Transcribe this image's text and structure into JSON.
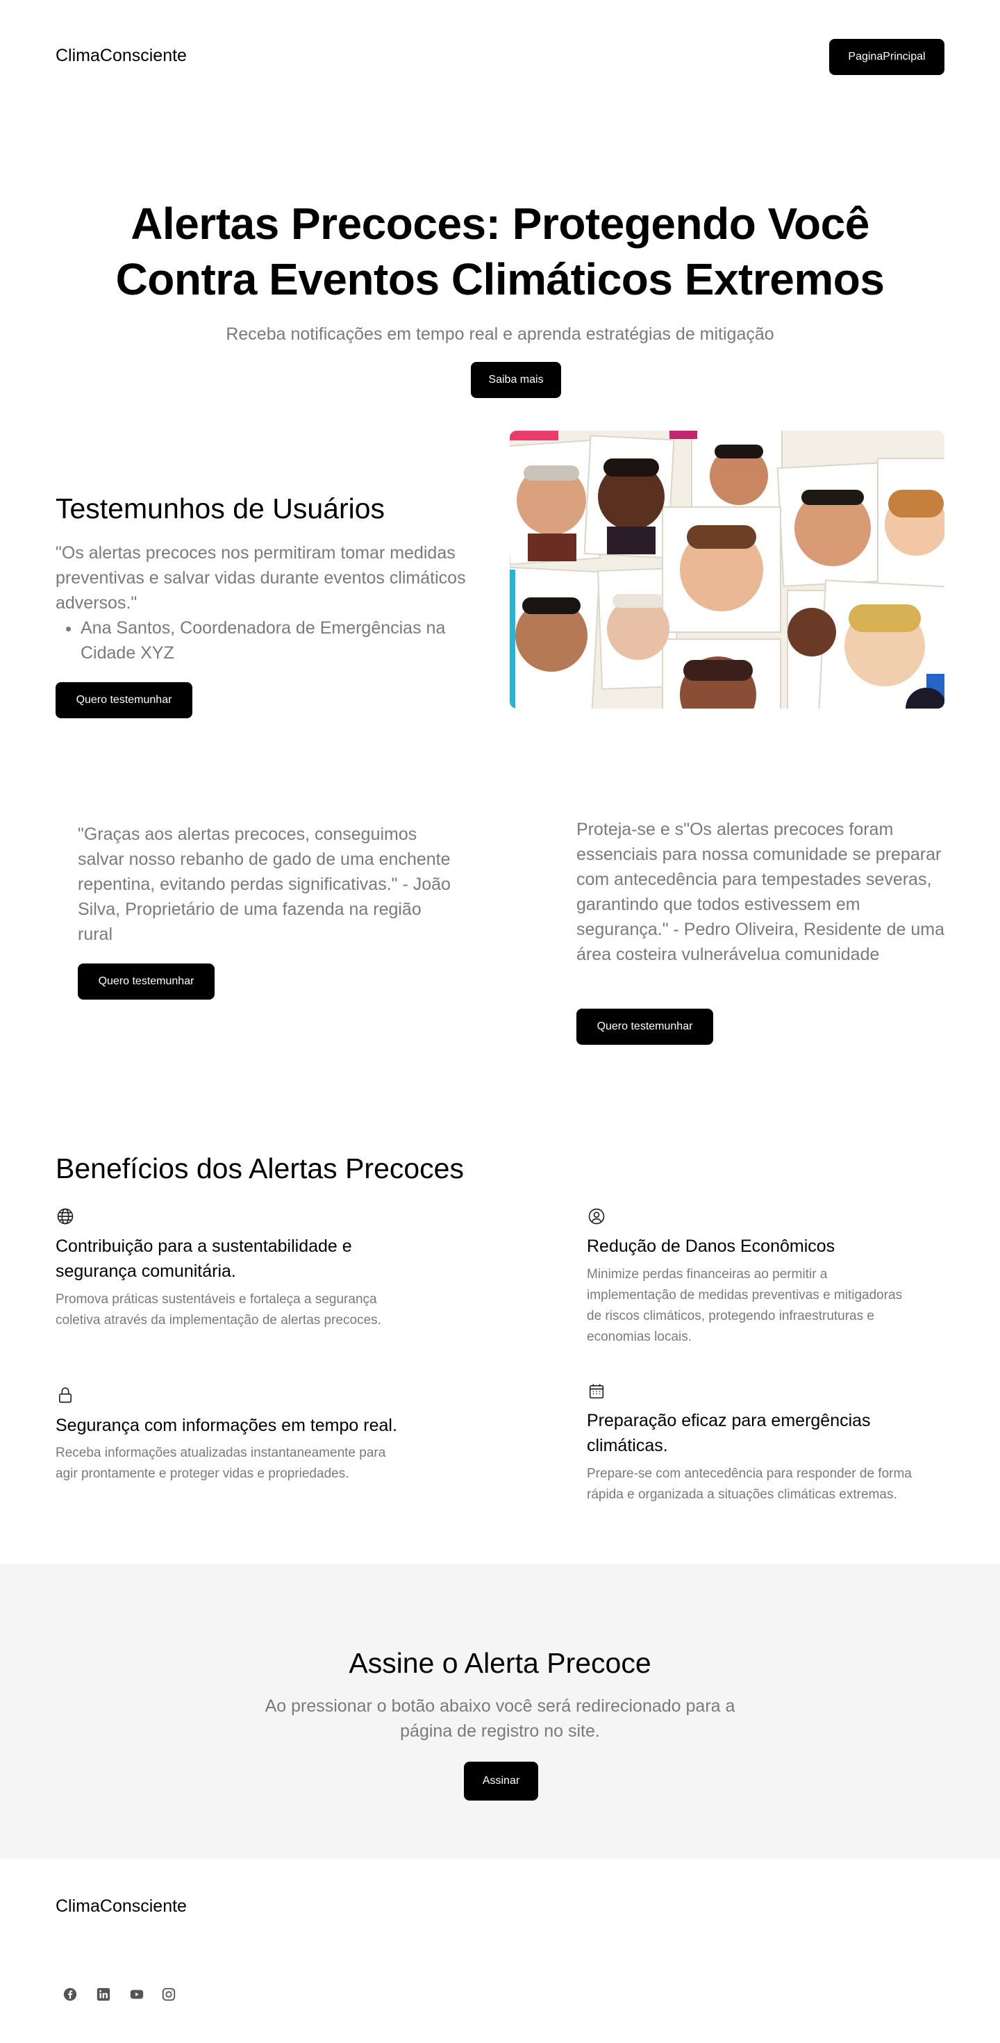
{
  "header": {
    "logo": "ClimaConsciente",
    "nav_button": "PaginaPrincipal"
  },
  "hero": {
    "title_line1": "Alertas Precoces: Protegendo Você",
    "title_line2": "Contra Eventos Climáticos Extremos",
    "subtitle": "Receba notificações em tempo real e aprenda estratégias de mitigação",
    "button": "Saiba mais"
  },
  "testimonials": {
    "title": "Testemunhos de Usuários",
    "quote1": "\"Os alertas precoces nos permitiram tomar medidas preventivas e salvar vidas durante eventos climáticos adversos.\"",
    "author1": "Ana Santos, Coordenadora de Emergências na Cidade XYZ",
    "button1": "Quero testemunhar",
    "quote2": "\"Graças aos alertas precoces, conseguimos salvar nosso rebanho de gado de uma enchente repentina, evitando perdas significativas.\" - João Silva, Proprietário de uma fazenda na região rural",
    "button2": "Quero testemunhar",
    "quote3": "Proteja-se e s\"Os alertas precoces foram essenciais para nossa comunidade se preparar com antecedência para tempestades severas, garantindo que todos estivessem em segurança.\" - Pedro Oliveira, Residente de uma área costeira vulnerávelua comunidade",
    "button3": "Quero testemunhar"
  },
  "benefits": {
    "title": "Benefícios dos Alertas Precoces",
    "items": [
      {
        "icon": "globe-icon",
        "title": "Contribuição para a sustentabilidade e segurança comunitária.",
        "text": " Promova práticas sustentáveis e fortaleça a segurança coletiva através da implementação de alertas precoces."
      },
      {
        "icon": "user-circle-icon",
        "title": "Redução de Danos Econômicos",
        "text": "Minimize perdas financeiras ao permitir a implementação de medidas preventivas e mitigadoras de riscos climáticos, protegendo infraestruturas e economias locais."
      },
      {
        "icon": "lock-icon",
        "title": "Segurança com informações em tempo real.",
        "text": "Receba informações atualizadas instantaneamente para agir prontamente e proteger vidas e propriedades."
      },
      {
        "icon": "calendar-icon",
        "title": "Preparação eficaz para emergências climáticas.",
        "text": "Prepare-se com antecedência para responder de forma rápida e organizada a situações climáticas extremas."
      }
    ]
  },
  "subscribe": {
    "title": "Assine o Alerta Precoce",
    "text_line1": "Ao pressionar o botão abaixo você será redirecionado para a",
    "text_line2": "página de  registro no site.",
    "button": "Assinar"
  },
  "footer": {
    "logo": "ClimaConsciente",
    "social": [
      "facebook-icon",
      "linkedin-icon",
      "youtube-icon",
      "instagram-icon"
    ]
  },
  "colors": {
    "primary": "#000000",
    "muted_text": "#7a7a7a",
    "section_bg": "#f5f5f5"
  }
}
